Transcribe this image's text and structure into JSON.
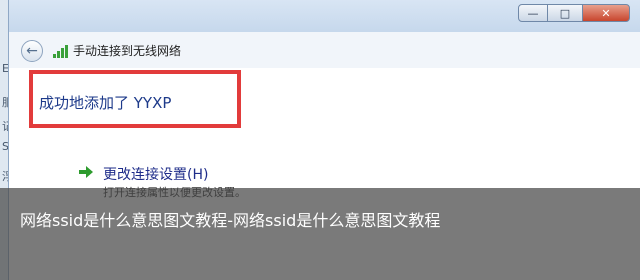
{
  "background_window": {
    "fragments": [
      "Ex",
      "服",
      "记",
      "S",
      "浮"
    ]
  },
  "window": {
    "controls": {
      "minimize": "—",
      "maximize": "□",
      "close": "✕"
    },
    "header": {
      "title": "手动连接到无线网络"
    },
    "success_message": "成功地添加了 YYXP",
    "change_settings": {
      "title": "更改连接设置(H)",
      "description": "打开连接属性以便更改设置。"
    },
    "colors": {
      "highlight_border": "#e23b3b",
      "link_text": "#1f2d8a",
      "success_text": "#1d3a8a"
    },
    "icons": {
      "back": "back-arrow-icon",
      "wireless": "signal-bars-icon",
      "link": "green-arrow-icon"
    }
  },
  "overlay": {
    "caption": "网络ssid是什么意思图文教程-网络ssid是什么意思图文教程"
  }
}
